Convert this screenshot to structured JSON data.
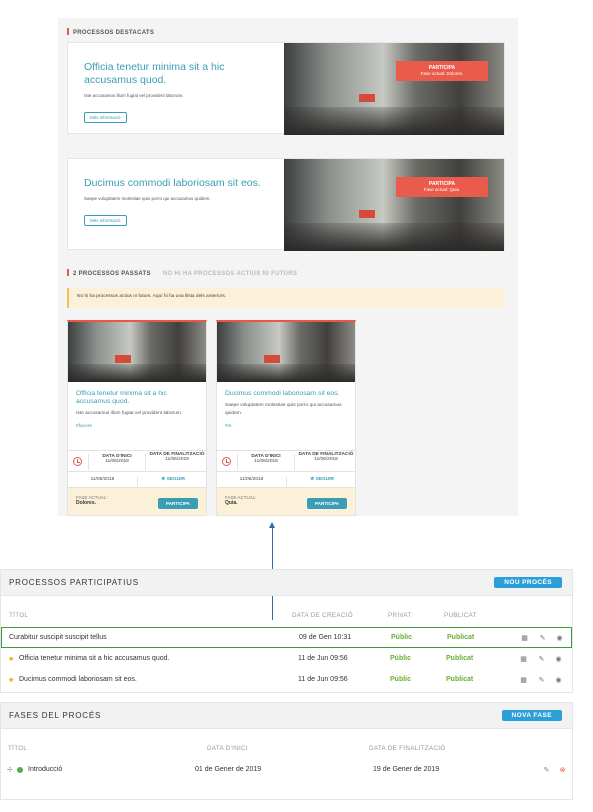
{
  "preview": {
    "featured_title": "PROCESSOS DESTACATS",
    "featured": [
      {
        "title": "Officia tenetur minima sit a hic accusamus quod.",
        "desc": "Iste accusamus illum fugiat vel provident laborum.",
        "more": "Més informació",
        "cta": "PARTICIPA",
        "phase": "Fase actual: Dolores."
      },
      {
        "title": "Ducimus commodi laboriosam sit eos.",
        "desc": "Saepe voluptatem molestiae quis porro qui accusamus quidem.",
        "more": "Més informació",
        "cta": "PARTICIPA",
        "phase": "Fase actual: Quia."
      }
    ],
    "past_title": "2 PROCESSOS PASSATS",
    "past_note": "NO HI HA PROCESSOS ACTIUS NI FUTURS",
    "notice": "No hi ha processos actius ni futurs. Aquí hi ha una llista dels anteriors.",
    "cards": [
      {
        "title": "Officia tenetur minima sit a hic accusamus quod.",
        "desc": "Iste accusamus illum fugiat vel provident laborum.",
        "tag": "#facere",
        "start_label": "DATA D'INICI",
        "start": "11/06/2018",
        "end_label": "DATA DE FINALITZACIÓ",
        "end": "11/06/2018",
        "follow_date": "11/06/2018",
        "follow": "★ SEGUIR",
        "phase_label": "FASE ACTUAL:",
        "phase": "Dolores.",
        "btn": "PARTICIPA"
      },
      {
        "title": "Ducimus commodi laboriosam sit eos.",
        "desc": "Saepe voluptatem molestiae quis porro qui accusamus quidem.",
        "tag": "#in",
        "start_label": "DATA D'INICI",
        "start": "11/06/2018",
        "end_label": "DATA DE FINALITZACIÓ",
        "end": "11/06/2018",
        "follow_date": "11/06/2018",
        "follow": "★ SEGUIR",
        "phase_label": "FASE ACTUAL:",
        "phase": "Quia.",
        "btn": "PARTICIPA"
      }
    ]
  },
  "processes": {
    "title": "PROCESSOS PARTICIPATIUS",
    "new_button": "NOU PROCÉS",
    "columns": {
      "title": "TÍTOL",
      "created": "DATA DE CREACIÓ",
      "private": "PRIVAT",
      "published": "PUBLICAT"
    },
    "rows": [
      {
        "star": "",
        "title": "Curabitur suscipit suscipit tellus",
        "created": "09 de Gen 10:31",
        "private": "Públic",
        "published": "Publicat"
      },
      {
        "star": "★",
        "title": "Officia tenetur minima sit a hic accusamus quod.",
        "created": "11 de Jun 09:56",
        "private": "Públic",
        "published": "Publicat"
      },
      {
        "star": "★",
        "title": "Ducimus commodi laboriosam sit eos.",
        "created": "11 de Jun 09:56",
        "private": "Públic",
        "published": "Publicat"
      }
    ]
  },
  "phases": {
    "title": "FASES DEL PROCÉS",
    "new_button": "NOVA FASE",
    "columns": {
      "title": "TÍTOL",
      "start": "DATA D'INICI",
      "end": "DATA DE FINALITZACIÓ"
    },
    "rows": [
      {
        "title": "Introducció",
        "start": "01 de Gener de 2019",
        "end": "19 de Gener de 2019"
      }
    ]
  }
}
